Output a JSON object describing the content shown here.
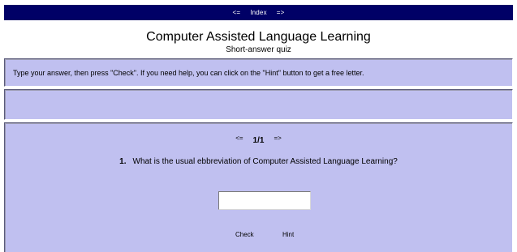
{
  "nav": {
    "prev": "<=",
    "index": "Index",
    "next": "=>"
  },
  "header": {
    "title": "Computer Assisted Language Learning",
    "subtitle": "Short-answer quiz"
  },
  "instructions": "Type your answer, then press \"Check\". If you need help, you can click on the \"Hint\" button to get a free letter.",
  "question_nav": {
    "prev": "<=",
    "counter": "1/1",
    "next": "=>"
  },
  "question": {
    "number": "1.",
    "text": "What is the usual ebbreviation of Computer Assisted Language Learning?"
  },
  "answer": {
    "value": "",
    "placeholder": ""
  },
  "buttons": {
    "check": "Check",
    "hint": "Hint"
  },
  "colors": {
    "navbar": "#000066",
    "panel": "#c0c0f0"
  }
}
